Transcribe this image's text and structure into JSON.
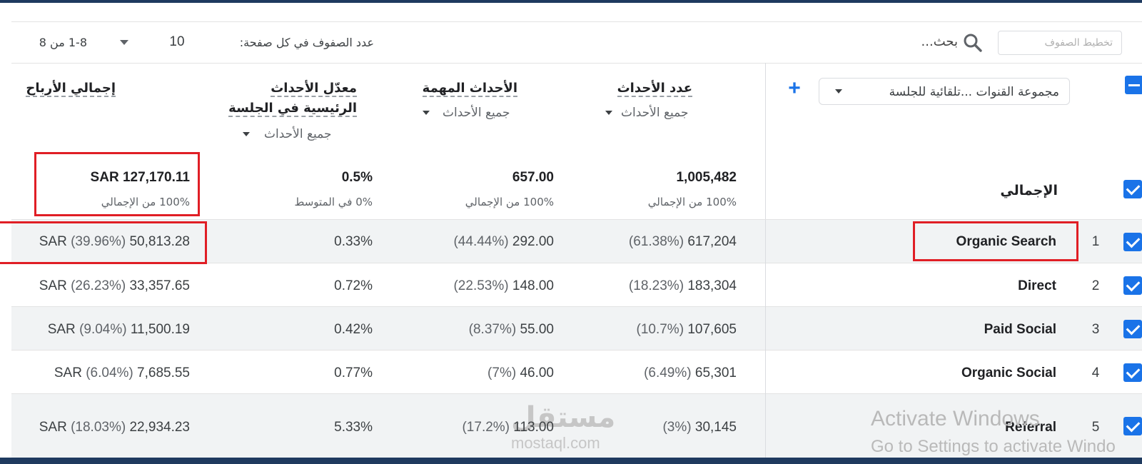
{
  "toolbar": {
    "filter_placeholder": "تخطيط الصفوف",
    "search_label": "بحث...",
    "rows_per_page_label": "عدد الصفوف في كل صفحة:",
    "rows_per_page_value": "10",
    "page_range": "1-8 من 8"
  },
  "header": {
    "dimension_dropdown": "مجموعة القنوات ...تلقائية للجلسة",
    "add_label": "+",
    "columns": [
      {
        "title": "عدد الأحداث",
        "filter": "جميع الأحداث"
      },
      {
        "title": "الأحداث المهمة",
        "filter": "جميع الأحداث"
      },
      {
        "title_line1": "معدّل الأحداث",
        "title_line2": "الرئيسية في الجلسة",
        "filter": "جميع الأحداث"
      },
      {
        "title": "إجمالي الأرباح"
      }
    ]
  },
  "totals": {
    "label": "الإجمالي",
    "event_count": "1,005,482",
    "event_count_sub": "100% من الإجمالي",
    "key_events": "657.00",
    "key_events_sub": "100% من الإجمالي",
    "rate": "0.5%",
    "rate_sub": "0% في المتوسط",
    "revenue": "SAR 127,170.11",
    "revenue_sub": "100% من الإجمالي"
  },
  "rows": [
    {
      "num": "1",
      "name": "Organic Search",
      "events_pct": "(61.38%)",
      "events": "617,204",
      "key_pct": "(44.44%)",
      "key": "292.00",
      "rate": "0.33%",
      "rev_pre": "SAR",
      "rev_pct": "(39.96%)",
      "rev": "50,813.28"
    },
    {
      "num": "2",
      "name": "Direct",
      "events_pct": "(18.23%)",
      "events": "183,304",
      "key_pct": "(22.53%)",
      "key": "148.00",
      "rate": "0.72%",
      "rev_pre": "SAR",
      "rev_pct": "(26.23%)",
      "rev": "33,357.65"
    },
    {
      "num": "3",
      "name": "Paid Social",
      "events_pct": "(10.7%)",
      "events": "107,605",
      "key_pct": "(8.37%)",
      "key": "55.00",
      "rate": "0.42%",
      "rev_pre": "SAR",
      "rev_pct": "(9.04%)",
      "rev": "11,500.19"
    },
    {
      "num": "4",
      "name": "Organic Social",
      "events_pct": "(6.49%)",
      "events": "65,301",
      "key_pct": "(7%)",
      "key": "46.00",
      "rate": "0.77%",
      "rev_pre": "SAR",
      "rev_pct": "(6.04%)",
      "rev": "7,685.55"
    },
    {
      "num": "5",
      "name": "Referral",
      "events_pct": "(3%)",
      "events": "30,145",
      "key_pct": "(17.2%)",
      "key": "113.00",
      "rate": "5.33%",
      "rev_pre": "SAR",
      "rev_pct": "(18.03%)",
      "rev": "22,934.23"
    }
  ],
  "watermark": {
    "brand_ar": "مستقل",
    "brand_en": "mostaql.com"
  },
  "os_overlay": {
    "activate_title": "Activate Windows",
    "activate_sub": "Go to Settings to activate Windo"
  },
  "colors": {
    "accent": "#1a73e8",
    "highlight": "#e01e25"
  }
}
